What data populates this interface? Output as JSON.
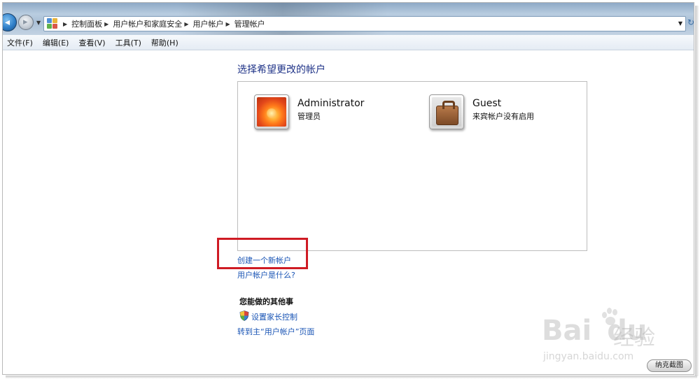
{
  "address_bar": {
    "breadcrumbs": [
      "控制面板",
      "用户帐户和家庭安全",
      "用户帐户",
      "管理帐户"
    ],
    "icons": [
      "control-panel-icon",
      "chevron-right-icon",
      "chevron-down-icon",
      "refresh-icon"
    ]
  },
  "menu": {
    "items": [
      "文件(F)",
      "编辑(E)",
      "查看(V)",
      "工具(T)",
      "帮助(H)"
    ]
  },
  "main": {
    "heading": "选择希望更改的帐户",
    "accounts": [
      {
        "name": "Administrator",
        "role": "管理员",
        "picture": "flower-picture"
      },
      {
        "name": "Guest",
        "role": "来宾帐户没有启用",
        "picture": "suitcase-picture"
      }
    ],
    "create_account_link": "创建一个新帐户",
    "what_is_link": "用户帐户是什么?",
    "other_heading": "您能做的其他事",
    "parental_control_link": "设置家长控制",
    "goto_main_link": "转到主“用户帐户”页面"
  },
  "watermark": {
    "brand": "Bai",
    "brand2": "du",
    "cn": "经验",
    "url": "jingyan.baidu.com"
  },
  "capture_button": "纳克截图",
  "colors": {
    "link": "#1a55b5",
    "heading": "#1e3287",
    "highlight": "#cf1b24"
  }
}
